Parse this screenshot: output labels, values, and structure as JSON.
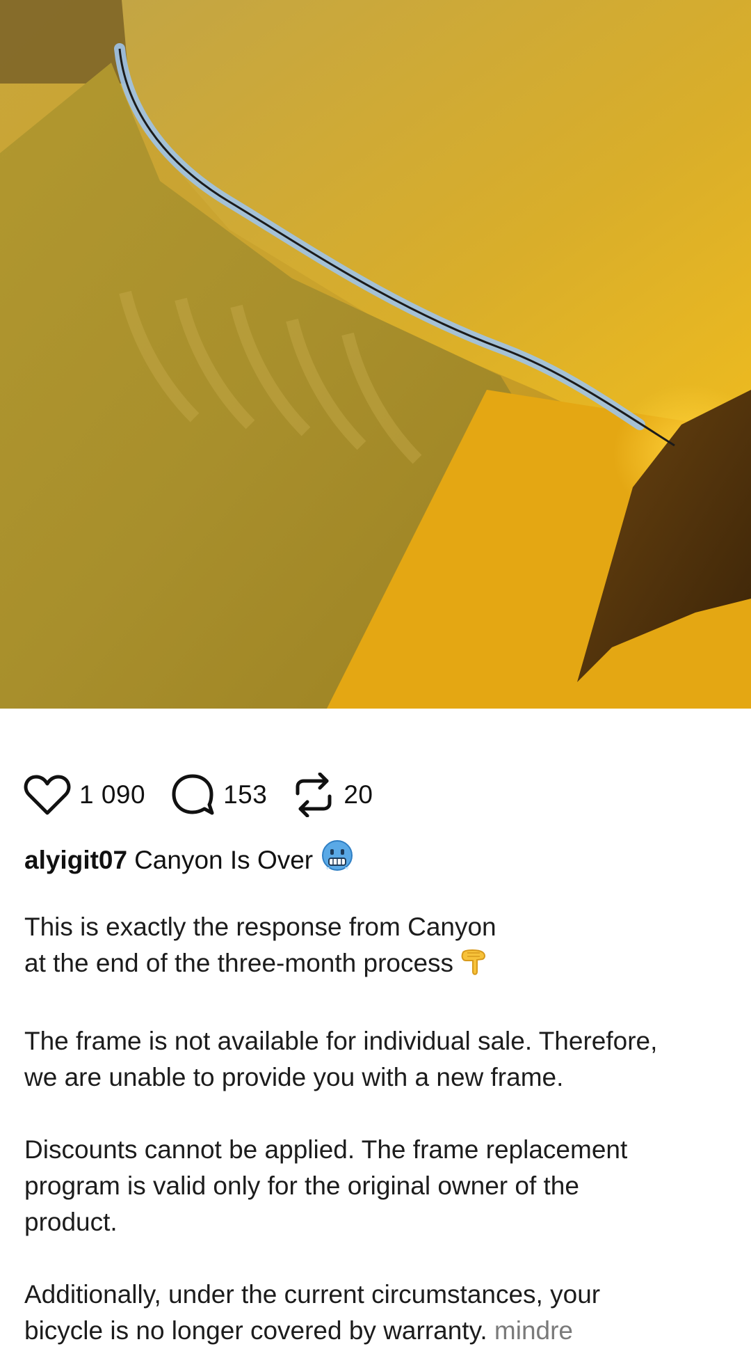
{
  "post": {
    "image": {
      "description_icon": "photo-frame-crack"
    },
    "actions": {
      "likes": "1 090",
      "comments": "153",
      "reposts": "20"
    },
    "author": {
      "username": "alyigit07",
      "title": "Canyon Is Over"
    },
    "body": {
      "p1_line1": "This is exactly the response from Canyon",
      "p1_line2": "at the end of the three-month process",
      "p2_line1": "The frame is not available for individual sale. Therefore,",
      "p2_line2": "we are unable to provide you with a new frame.",
      "p3_line1": "Discounts cannot be applied. The frame replacement",
      "p3_line2": "program is valid only for the original owner of the",
      "p3_line3": "product.",
      "p4_line1": "Additionally, under the current circumstances, your",
      "p4_line2": "bicycle is no longer covered by warranty.",
      "more": "mindre"
    }
  },
  "colors": {
    "text": "#111111",
    "muted": "#7a7a7a",
    "frame_yellow": "#d9a418"
  },
  "icons": {
    "like": "heart-icon",
    "comment": "comment-bubble-icon",
    "repost": "repost-icon",
    "emoji_title": "cold-face-emoji-icon",
    "emoji_body": "pointing-down-emoji-icon"
  }
}
